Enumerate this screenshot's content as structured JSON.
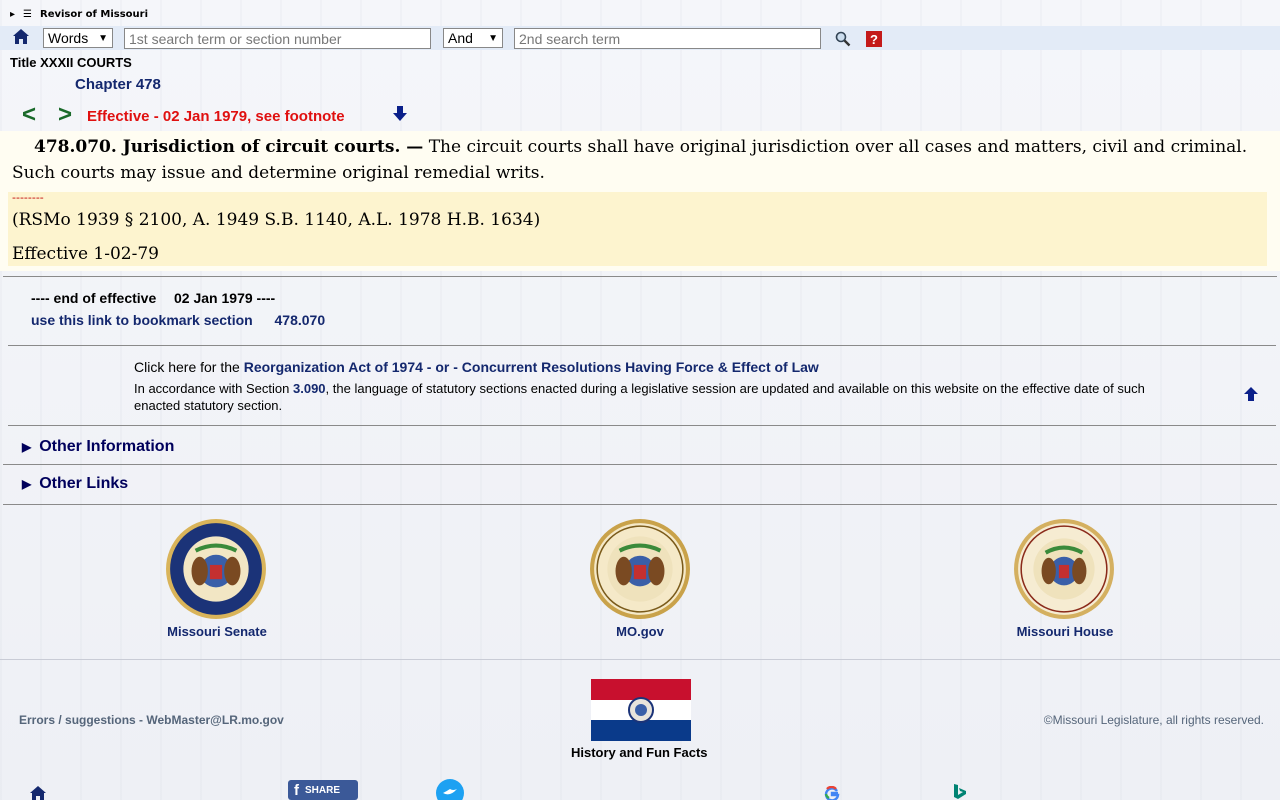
{
  "header": {
    "site_title": "Revisor of Missouri"
  },
  "search": {
    "mode_value": "Words",
    "term1_placeholder": "1st search term or section number",
    "operator_value": "And",
    "term2_placeholder": "2nd search term"
  },
  "breadcrumb": {
    "title": "Title XXXII COURTS",
    "chapter": "Chapter 478"
  },
  "nav": {
    "prev": "<",
    "next": ">",
    "effective": "Effective - 02 Jan 1979, see footnote"
  },
  "section": {
    "heading": "478.070.  Jurisdiction of circuit courts. —",
    "body": " The circuit courts shall have original jurisdiction over all cases and matters, civil and criminal.  Such courts may issue and determine original remedial writs.",
    "dashes": "--------",
    "history": "(RSMo 1939 § 2100, A. 1949 S.B. 1140, A.L. 1978 H.B. 1634)",
    "effective_note": "Effective 1-02-79"
  },
  "end_block": {
    "end_prefix": "---- end of effective",
    "end_date": "02 Jan 1979",
    "end_suffix": "----",
    "bookmark_label": "use this link to bookmark section",
    "bookmark_section": "478.070"
  },
  "notice": {
    "reorg_prefix": "Click here for the",
    "reorg_link": "Reorganization Act of 1974 - or - Concurrent Resolutions Having Force & Effect of Law",
    "accord_prefix": "In accordance with Section",
    "accord_link": "3.090",
    "accord_text": ", the language of statutory sections enacted during a legislative session are updated and available on this website on the effective date of such enacted statutory section."
  },
  "expanders": {
    "other_information": "Other Information",
    "other_links": "Other Links"
  },
  "seals": {
    "senate": "Missouri Senate",
    "mogov": "MO.gov",
    "house": "Missouri House"
  },
  "footer": {
    "errors": "Errors / suggestions - WebMaster@LR.mo.gov",
    "copyright": "©Missouri Legislature, all rights reserved.",
    "history": "History and Fun Facts",
    "share": "SHARE"
  },
  "colors": {
    "link_navy": "#14286e",
    "effective_red": "#e01010",
    "nav_green": "#1a6a2a",
    "footnote_bg": "#fdf4cf"
  }
}
